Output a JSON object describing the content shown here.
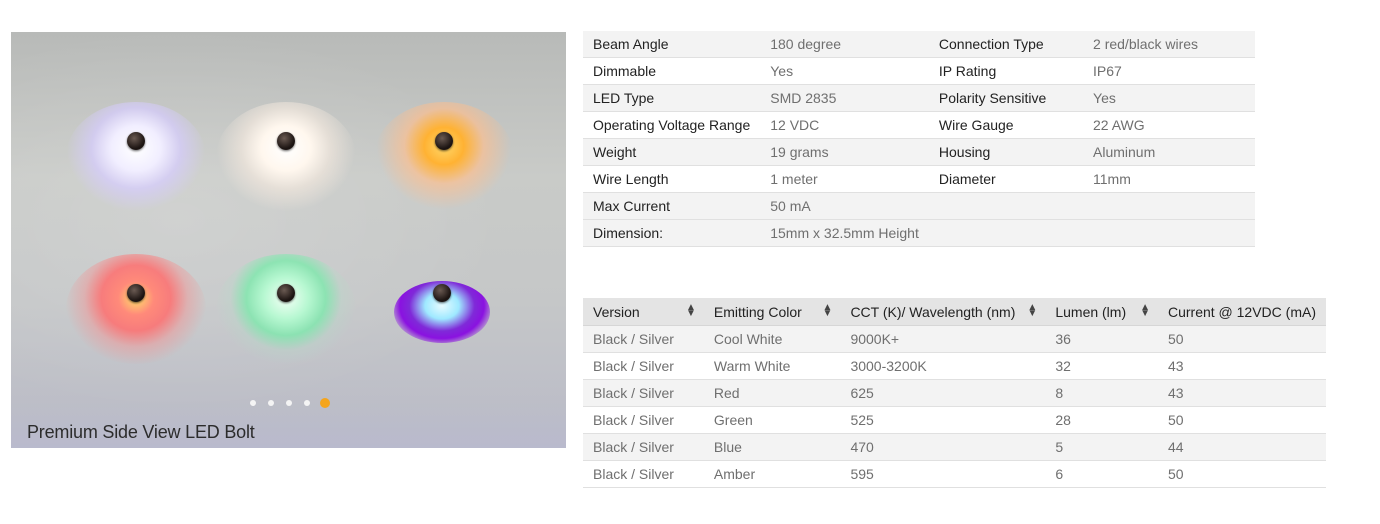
{
  "slider": {
    "caption": "Premium Side View LED Bolt",
    "dots_count": 5,
    "active_dot": 5,
    "leds": [
      {
        "color_name": "cool-white",
        "glow": "#f4f2ff",
        "ring": "#d8ccff"
      },
      {
        "color_name": "warm-white",
        "glow": "#fff6ea",
        "ring": "#f2e6da"
      },
      {
        "color_name": "amber",
        "glow": "#ffb33a",
        "ring": "#ffd6a0"
      },
      {
        "color_name": "red",
        "glow": "#ff6a6a",
        "ring": "#ffb0a8"
      },
      {
        "color_name": "green",
        "glow": "#8cf5c8",
        "ring": "#c8f7dc"
      },
      {
        "color_name": "blue",
        "glow": "#9b1fe6",
        "ring": "#d4f2ff"
      }
    ],
    "accent_color": "#f5a51c"
  },
  "specs": [
    {
      "k1": "Beam Angle",
      "v1": "180 degree",
      "k2": "Connection Type",
      "v2": "2 red/black wires"
    },
    {
      "k1": "Dimmable",
      "v1": "Yes",
      "k2": "IP Rating",
      "v2": "IP67"
    },
    {
      "k1": "LED Type",
      "v1": "SMD 2835",
      "k2": "Polarity Sensitive",
      "v2": "Yes"
    },
    {
      "k1": "Operating Voltage Range",
      "v1": "12 VDC",
      "k2": "Wire Gauge",
      "v2": "22 AWG"
    },
    {
      "k1": "Weight",
      "v1": "19 grams",
      "k2": "Housing",
      "v2": "Aluminum"
    },
    {
      "k1": "Wire Length",
      "v1": "1 meter",
      "k2": "Diameter",
      "v2": "11mm"
    },
    {
      "k1": "Max Current",
      "v1": "50 mA",
      "k2": "",
      "v2": ""
    }
  ],
  "dimension": {
    "label": "Dimension:",
    "value": "15mm x 32.5mm Height"
  },
  "versions": {
    "headers": [
      "Version",
      "Emitting Color",
      "CCT (K)/ Wavelength (nm)",
      "Lumen (lm)",
      "Current @ 12VDC (mA)"
    ],
    "rows": [
      [
        "Black / Silver",
        "Cool White",
        "9000K+",
        "36",
        "50"
      ],
      [
        "Black / Silver",
        "Warm White",
        "3000-3200K",
        "32",
        "43"
      ],
      [
        "Black / Silver",
        "Red",
        "625",
        "8",
        "43"
      ],
      [
        "Black / Silver",
        "Green",
        "525",
        "28",
        "50"
      ],
      [
        "Black / Silver",
        "Blue",
        "470",
        "5",
        "44"
      ],
      [
        "Black / Silver",
        "Amber",
        "595",
        "6",
        "50"
      ]
    ]
  }
}
